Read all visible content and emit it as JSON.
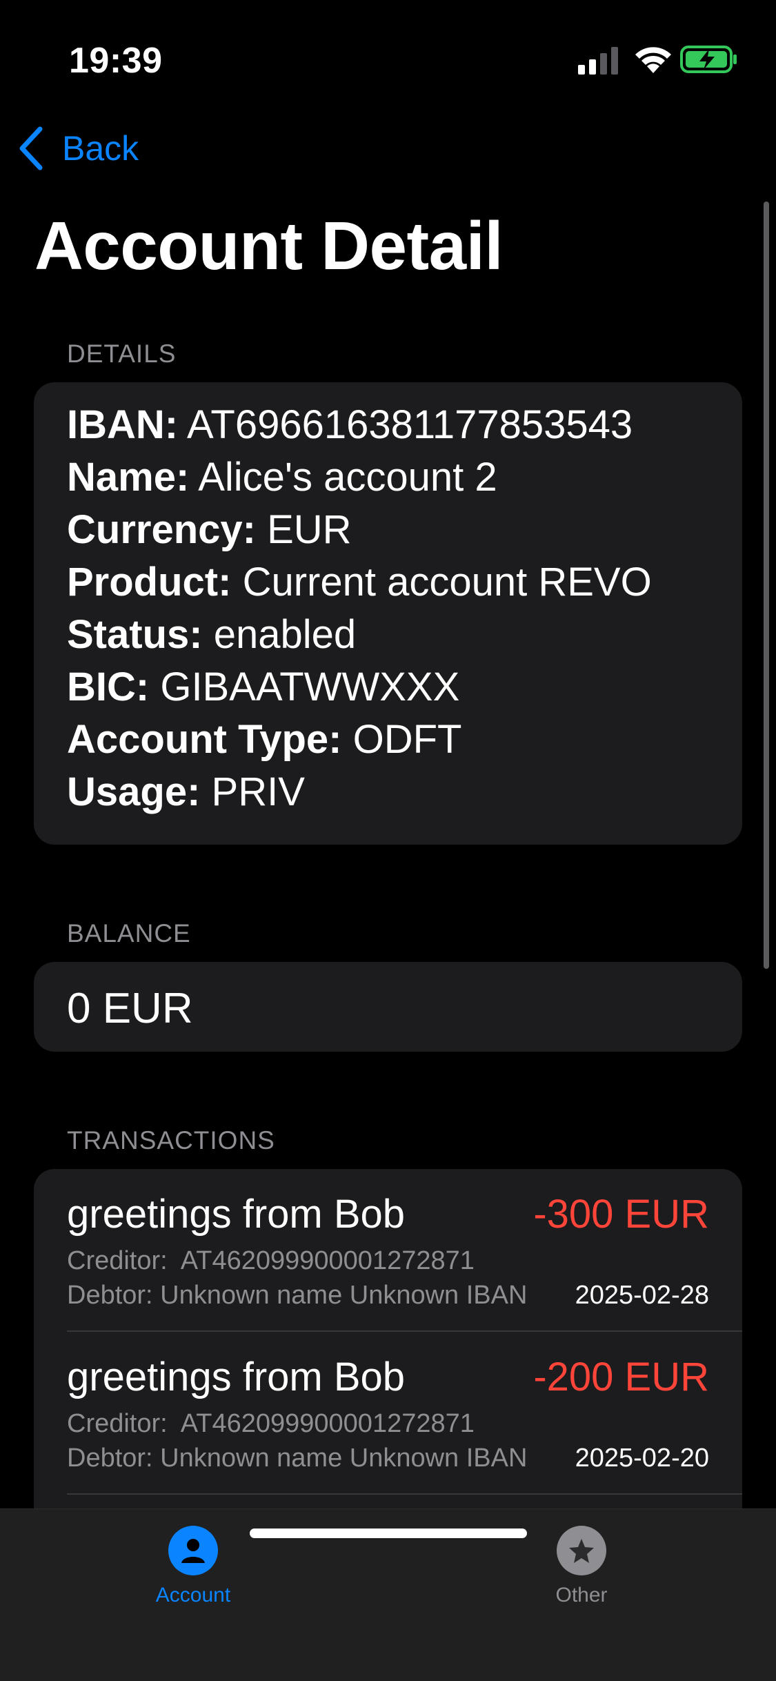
{
  "status_bar": {
    "time": "19:39",
    "signal_icon": "cellular-signal-icon",
    "wifi_icon": "wifi-icon",
    "battery_icon": "battery-charging-icon",
    "battery_color": "#34c759"
  },
  "nav": {
    "back_label": "Back",
    "title": "Account Detail"
  },
  "details": {
    "header": "DETAILS",
    "rows": [
      {
        "key": "IBAN:",
        "value": "AT696616381177853543"
      },
      {
        "key": "Name:",
        "value": "Alice's account 2"
      },
      {
        "key": "Currency:",
        "value": "EUR"
      },
      {
        "key": "Product:",
        "value": "Current account REVO"
      },
      {
        "key": "Status:",
        "value": "enabled"
      },
      {
        "key": "BIC:",
        "value": "GIBAATWWXXX"
      },
      {
        "key": "Account Type:",
        "value": "ODFT"
      },
      {
        "key": "Usage:",
        "value": "PRIV"
      }
    ]
  },
  "balance": {
    "header": "BALANCE",
    "value": "0 EUR"
  },
  "transactions": {
    "header": "TRANSACTIONS",
    "items": [
      {
        "title": "greetings from Bob",
        "amount": "-300 EUR",
        "creditor": "Creditor:  AT462099900001272871",
        "debtor": "Debtor: Unknown name Unknown IBAN",
        "date": "2025-02-28"
      },
      {
        "title": "greetings from Bob",
        "amount": "-200 EUR",
        "creditor": "Creditor:  AT462099900001272871",
        "debtor": "Debtor: Unknown name Unknown IBAN",
        "date": "2025-02-20"
      }
    ]
  },
  "tab_bar": {
    "tabs": [
      {
        "label": "Account",
        "icon": "person-icon",
        "selected": true
      },
      {
        "label": "Other",
        "icon": "star-icon",
        "selected": false
      }
    ]
  },
  "colors": {
    "accent": "#0a84ff",
    "negative": "#ff453a",
    "card": "#1c1c1e",
    "secondary_text": "#8e8e93"
  }
}
